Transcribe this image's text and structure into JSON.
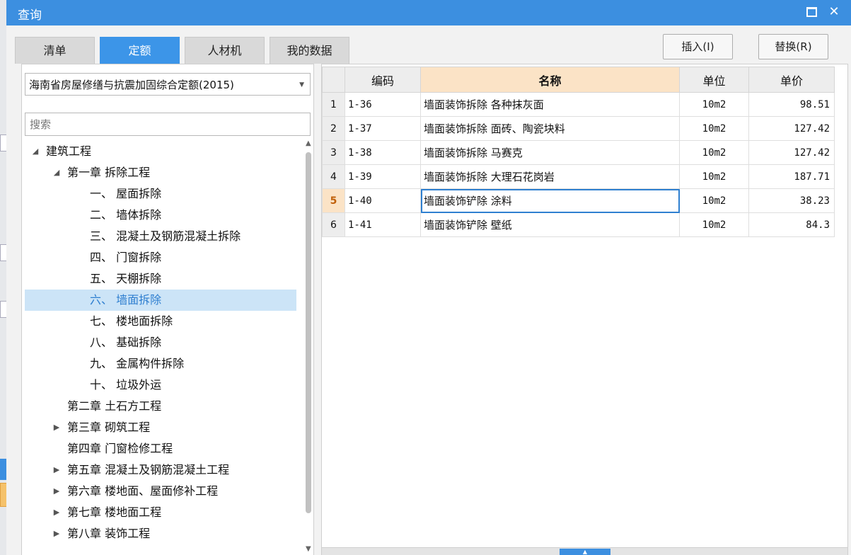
{
  "window": {
    "title": "查询"
  },
  "tabs": [
    {
      "label": "清单",
      "active": false
    },
    {
      "label": "定额",
      "active": true
    },
    {
      "label": "人材机",
      "active": false
    },
    {
      "label": "我的数据",
      "active": false
    }
  ],
  "actions": {
    "insert": "插入(I)",
    "replace": "替换(R)"
  },
  "quota_library": {
    "selected": "海南省房屋修缮与抗震加固综合定额(2015)"
  },
  "search": {
    "placeholder": "搜索"
  },
  "tree": [
    {
      "toggle": "expanded",
      "label": "建筑工程"
    },
    {
      "toggle": "expanded",
      "label": "第一章 拆除工程"
    },
    {
      "toggle": "none",
      "label": "一、 屋面拆除"
    },
    {
      "toggle": "none",
      "label": "二、 墙体拆除"
    },
    {
      "toggle": "none",
      "label": "三、 混凝土及钢筋混凝土拆除"
    },
    {
      "toggle": "none",
      "label": "四、 门窗拆除"
    },
    {
      "toggle": "none",
      "label": "五、 天棚拆除"
    },
    {
      "toggle": "none",
      "label": "六、 墙面拆除",
      "selected": true
    },
    {
      "toggle": "none",
      "label": "七、 楼地面拆除"
    },
    {
      "toggle": "none",
      "label": "八、 基础拆除"
    },
    {
      "toggle": "none",
      "label": "九、 金属构件拆除"
    },
    {
      "toggle": "none",
      "label": "十、 垃圾外运"
    },
    {
      "toggle": "none",
      "label": "第二章 土石方工程"
    },
    {
      "toggle": "collapsed",
      "label": "第三章 砌筑工程"
    },
    {
      "toggle": "none",
      "label": "第四章 门窗检修工程"
    },
    {
      "toggle": "collapsed",
      "label": "第五章 混凝土及钢筋混凝土工程"
    },
    {
      "toggle": "collapsed",
      "label": "第六章 楼地面、屋面修补工程"
    },
    {
      "toggle": "collapsed",
      "label": "第七章 楼地面工程"
    },
    {
      "toggle": "collapsed",
      "label": "第八章 装饰工程"
    }
  ],
  "table": {
    "columns": [
      "编码",
      "名称",
      "单位",
      "单价"
    ],
    "rows": [
      {
        "n": "1",
        "code": "1-36",
        "name": "墙面装饰拆除 各种抹灰面",
        "unit": "10m2",
        "price": "98.51"
      },
      {
        "n": "2",
        "code": "1-37",
        "name": "墙面装饰拆除 面砖、陶瓷块料",
        "unit": "10m2",
        "price": "127.42"
      },
      {
        "n": "3",
        "code": "1-38",
        "name": "墙面装饰拆除 马赛克",
        "unit": "10m2",
        "price": "127.42"
      },
      {
        "n": "4",
        "code": "1-39",
        "name": "墙面装饰拆除 大理石花岗岩",
        "unit": "10m2",
        "price": "187.71"
      },
      {
        "n": "5",
        "code": "1-40",
        "name": "墙面装饰铲除 涂料",
        "unit": "10m2",
        "price": "38.23"
      },
      {
        "n": "6",
        "code": "1-41",
        "name": "墙面装饰铲除 壁纸",
        "unit": "10m2",
        "price": "84.3"
      }
    ],
    "current_row": 5
  },
  "icons": {
    "maximize": "maximize-icon",
    "close": "close-icon",
    "dropdown": "chevron-down-icon"
  },
  "colors": {
    "accent": "#3c8fe0",
    "selection": "#cce4f7",
    "header_highlight": "#fbe3c6"
  }
}
